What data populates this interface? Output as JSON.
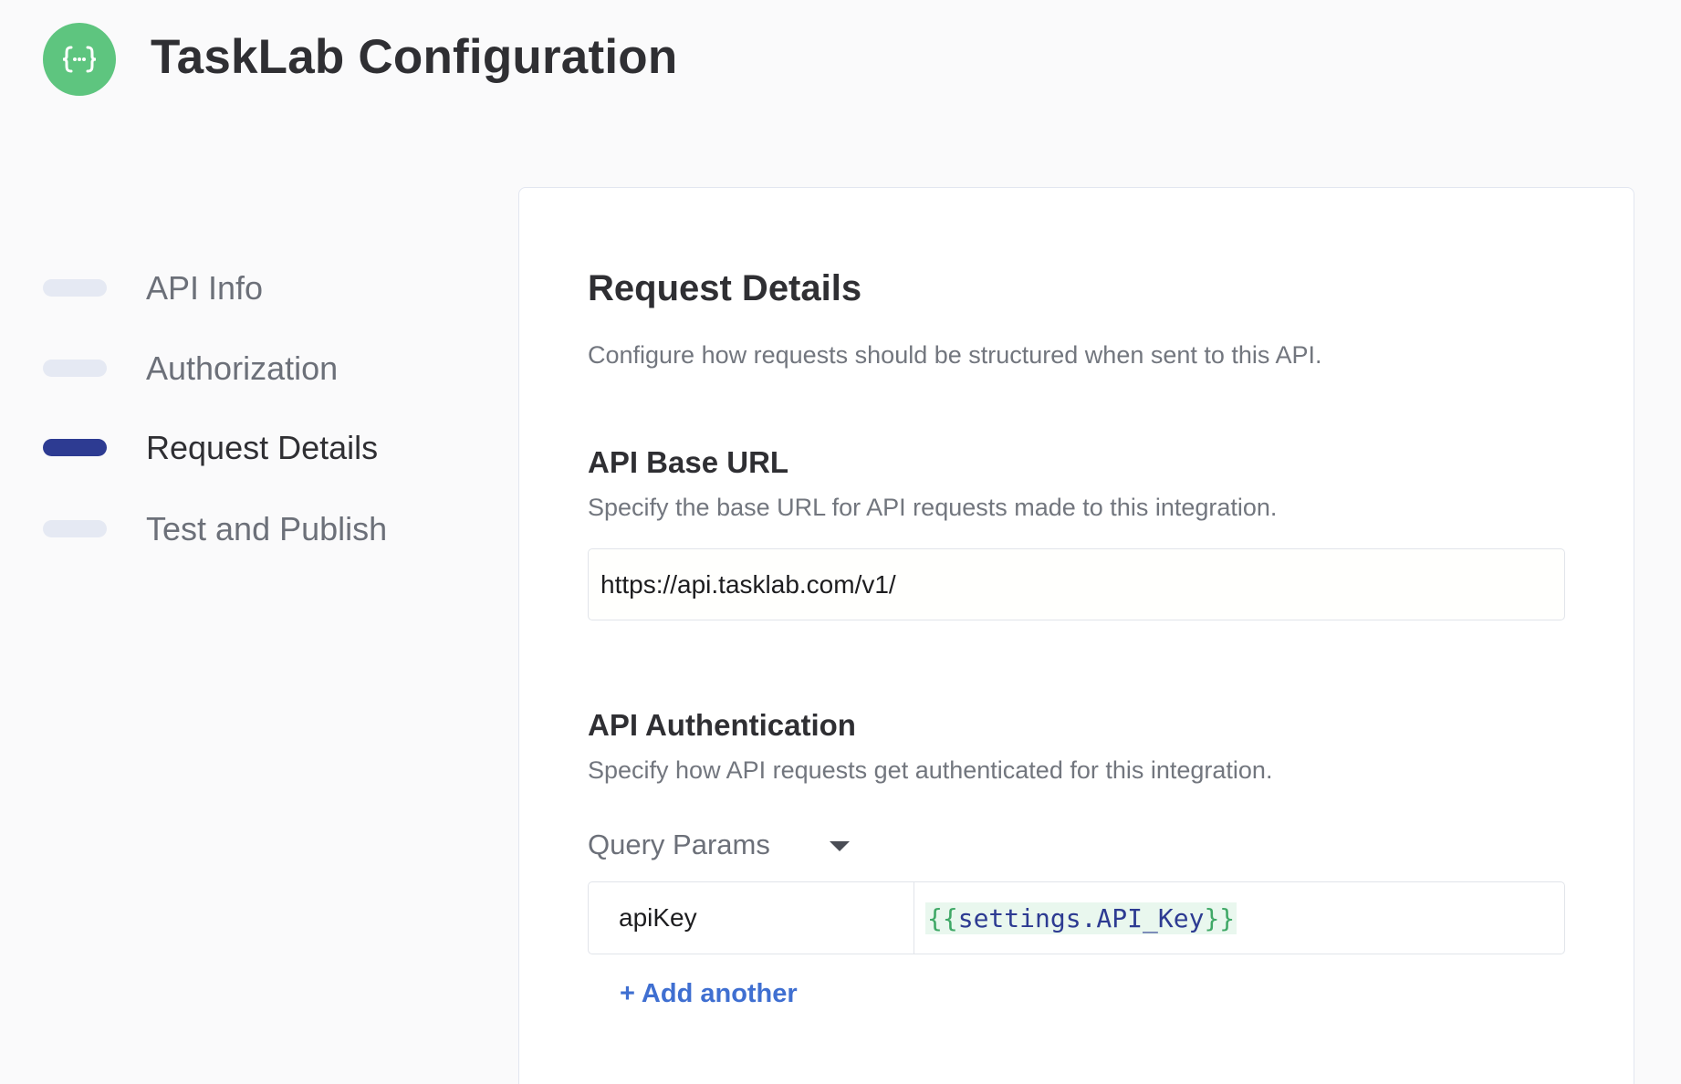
{
  "header": {
    "title": "TaskLab Configuration",
    "logo_glyph": "{··}",
    "logo_color": "#5ec57f"
  },
  "steps": [
    {
      "label": "API Info",
      "active": false
    },
    {
      "label": "Authorization",
      "active": false
    },
    {
      "label": "Request Details",
      "active": true
    },
    {
      "label": "Test and Publish",
      "active": false
    }
  ],
  "main": {
    "title": "Request Details",
    "description": "Configure how requests should be structured when sent to this API.",
    "base_url": {
      "title": "API Base URL",
      "description": "Specify the base URL for API requests made to this integration.",
      "value": "https://api.tasklab.com/v1/"
    },
    "auth": {
      "title": "API Authentication",
      "description": "Specify how API requests get authenticated for this integration.",
      "mode_label": "Query Params",
      "params": [
        {
          "key": "apiKey",
          "value_open": "{{",
          "value_body": "settings.API_Key",
          "value_close": "}}"
        }
      ],
      "add_label": "+ Add another"
    }
  },
  "colors": {
    "accent": "#2d3b92",
    "link": "#3f6fd1",
    "step_inactive": "#e5e9f3",
    "token_bg": "#e9f7ee"
  }
}
